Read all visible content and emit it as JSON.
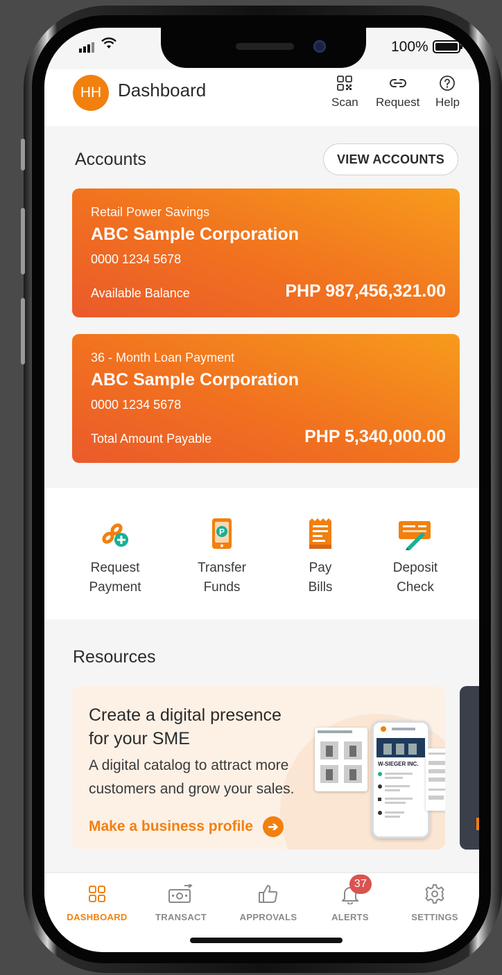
{
  "status_bar": {
    "battery": "100%"
  },
  "header": {
    "avatar_initials": "HH",
    "title": "Dashboard",
    "actions": [
      {
        "label": "Scan",
        "icon": "qr-code-icon"
      },
      {
        "label": "Request",
        "icon": "link-icon"
      },
      {
        "label": "Help",
        "icon": "help-icon"
      }
    ]
  },
  "accounts": {
    "title": "Accounts",
    "view_button": "VIEW ACCOUNTS",
    "cards": [
      {
        "type": "Retail Power Savings",
        "name": "ABC Sample Corporation",
        "number": "0000 1234 5678",
        "label": "Available Balance",
        "amount": "PHP 987,456,321.00"
      },
      {
        "type": "36 - Month Loan Payment",
        "name": "ABC Sample Corporation",
        "number": "0000 1234 5678",
        "label": "Total Amount Payable",
        "amount": "PHP 5,340,000.00"
      }
    ]
  },
  "quick_actions": [
    {
      "line1": "Request",
      "line2": "Payment",
      "icon": "request-payment-icon"
    },
    {
      "line1": "Transfer",
      "line2": "Funds",
      "icon": "transfer-funds-icon"
    },
    {
      "line1": "Pay",
      "line2": "Bills",
      "icon": "pay-bills-icon"
    },
    {
      "line1": "Deposit",
      "line2": "Check",
      "icon": "deposit-check-icon"
    }
  ],
  "resources": {
    "title": "Resources",
    "promo": {
      "title": "Create a digital presence for your SME",
      "subtitle": "A digital catalog to attract more customers and grow your sales.",
      "link": "Make a business profile",
      "mock_company": "W-SIEGER INC."
    }
  },
  "bottom_nav": [
    {
      "label": "DASHBOARD",
      "icon": "dashboard-grid-icon",
      "active": true
    },
    {
      "label": "TRANSACT",
      "icon": "transact-cash-icon",
      "active": false
    },
    {
      "label": "APPROVALS",
      "icon": "thumbs-up-icon",
      "active": false
    },
    {
      "label": "ALERTS",
      "icon": "bell-icon",
      "active": false,
      "badge": "37"
    },
    {
      "label": "SETTINGS",
      "icon": "gear-icon",
      "active": false
    }
  ],
  "colors": {
    "accent": "#f2800f",
    "card_start": "#f79b1c",
    "card_end": "#ea5a2b",
    "badge": "#d9534f"
  }
}
